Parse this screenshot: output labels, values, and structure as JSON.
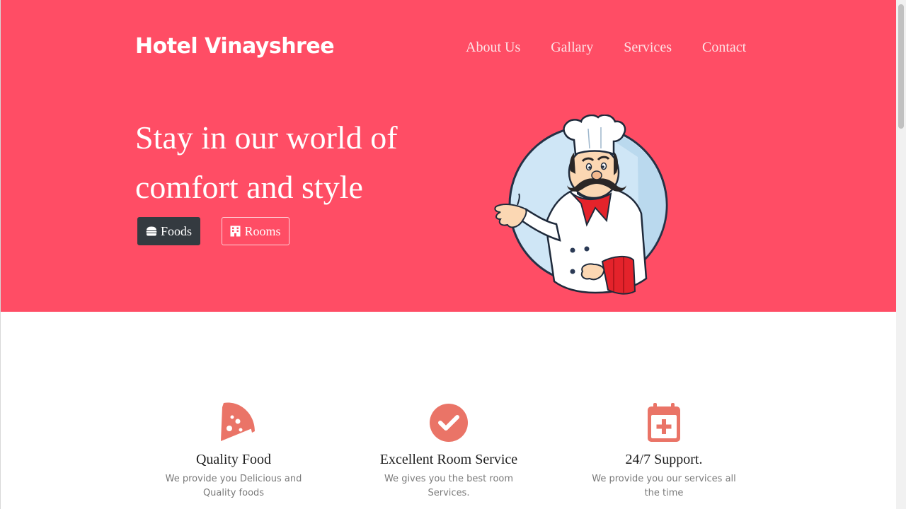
{
  "brand": {
    "title": "Hotel Vinayshree"
  },
  "nav": {
    "items": [
      "About Us",
      "Gallary",
      "Services",
      "Contact"
    ]
  },
  "hero": {
    "headline_line1": "Stay in our world of",
    "headline_line2": "comfort and style",
    "buttons": {
      "foods": {
        "label": "Foods",
        "icon": "hamburger-icon"
      },
      "rooms": {
        "label": "Rooms",
        "icon": "building-icon"
      }
    },
    "image": "chef-illustration"
  },
  "features": [
    {
      "icon": "pizza-slice-icon",
      "title": "Quality Food",
      "desc": "We provide you Delicious and Quality foods"
    },
    {
      "icon": "check-circle-icon",
      "title": "Excellent Room Service",
      "desc": "We gives you the best room Services."
    },
    {
      "icon": "calendar-plus-icon",
      "title": "24/7 Support.",
      "desc": "We provide you our services all the time"
    }
  ],
  "colors": {
    "hero_bg": "#ff4d65",
    "accent_icon": "#ea7467",
    "dark_button": "#343a40"
  }
}
